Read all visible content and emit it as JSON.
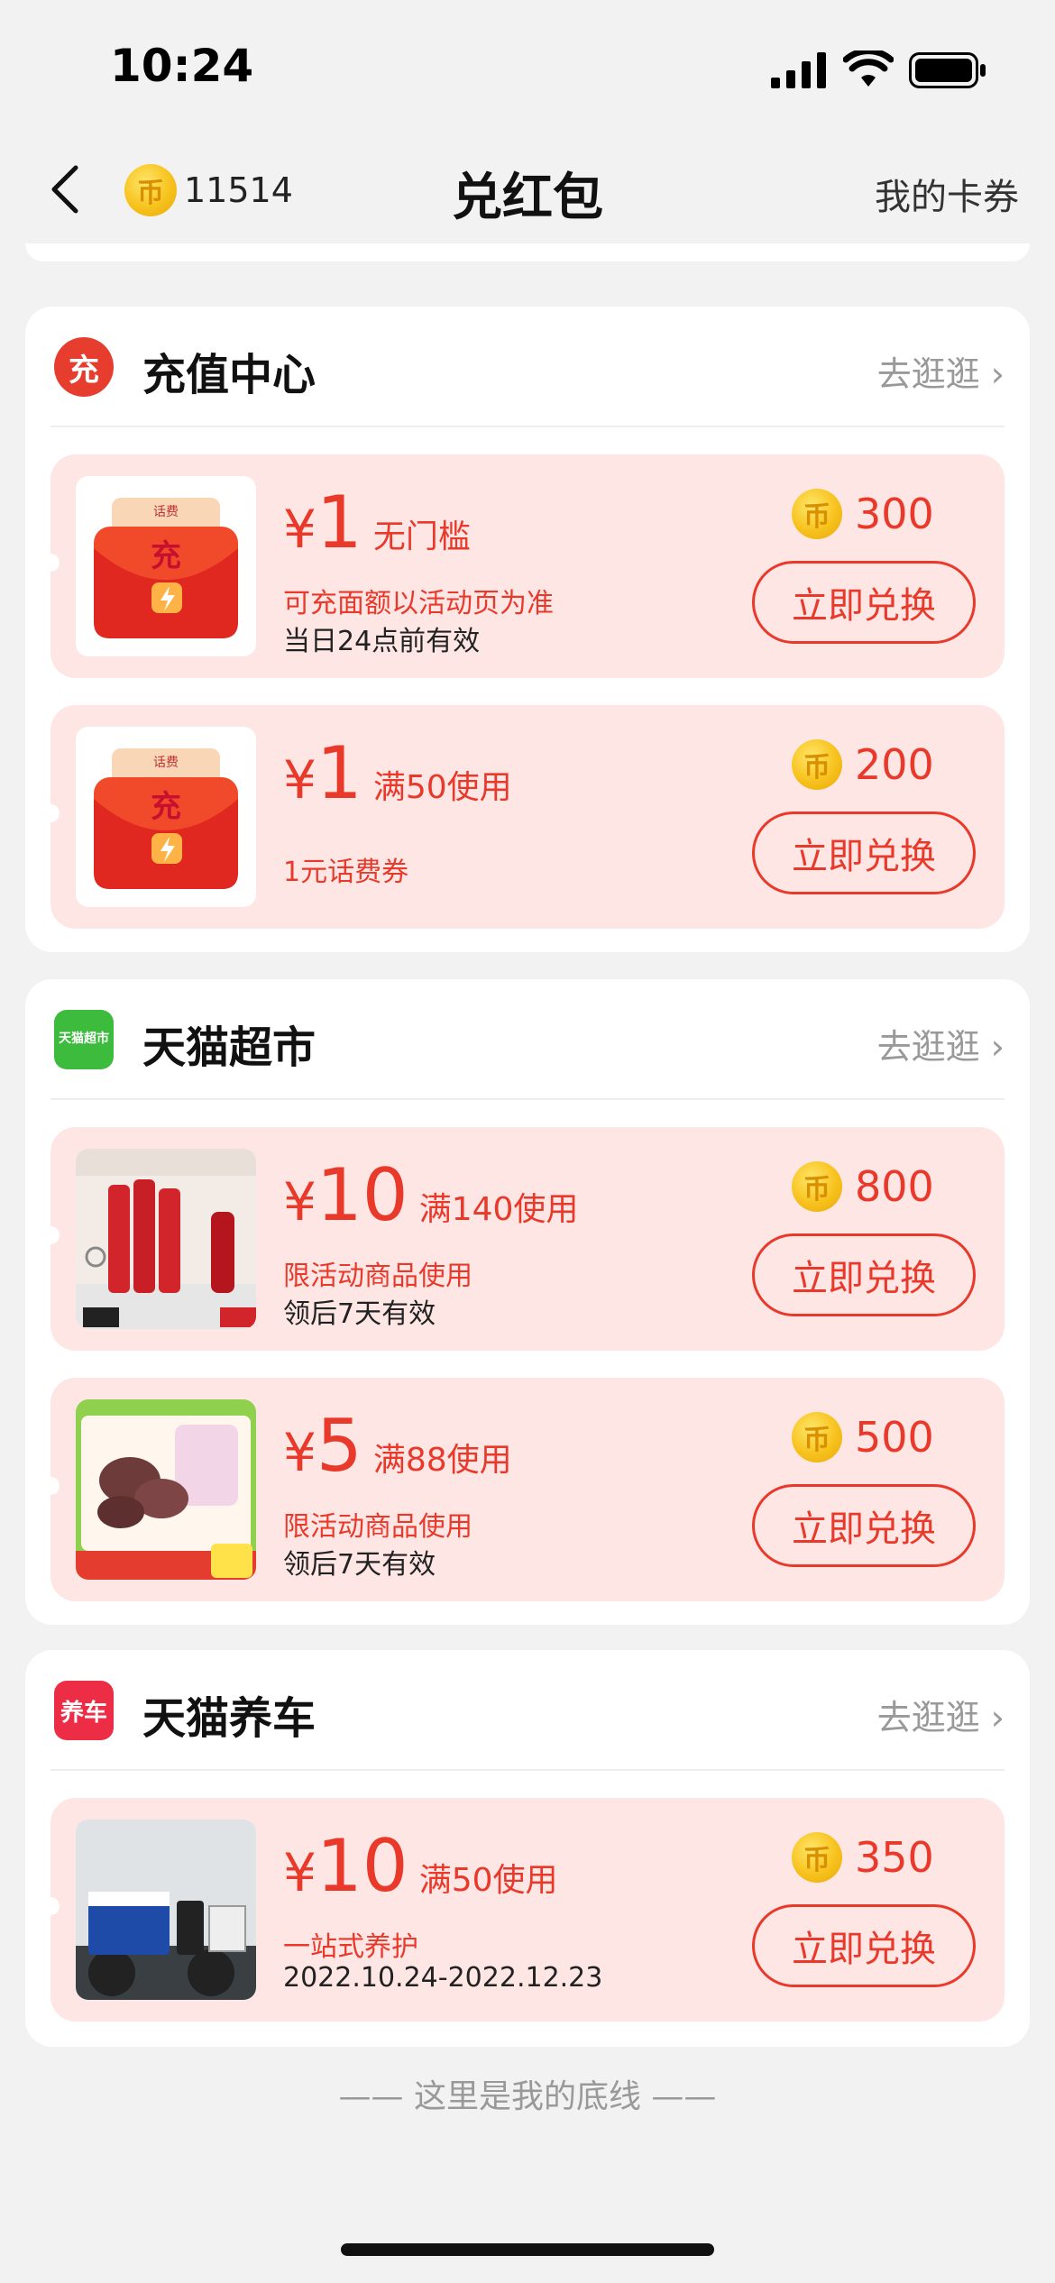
{
  "status_bar": {
    "time": "10:24"
  },
  "nav": {
    "coin_balance": "11514",
    "title": "兑红包",
    "my_coupons": "我的卡券"
  },
  "sections": [
    {
      "title": "充值中心",
      "icon_label": "充",
      "link": "去逛逛",
      "coupons": [
        {
          "currency": "¥",
          "amount": "1",
          "condition": "无门槛",
          "desc": "可充面额以活动页为准",
          "validity": "当日24点前有效",
          "cost": "300",
          "button": "立即兑换",
          "thumb_label_top": "话费",
          "thumb_label": "充"
        },
        {
          "currency": "¥",
          "amount": "1",
          "condition": "满50使用",
          "desc": "1元话费券",
          "validity": "",
          "cost": "200",
          "button": "立即兑换",
          "thumb_label_top": "话费",
          "thumb_label": "充"
        }
      ]
    },
    {
      "title": "天猫超市",
      "icon_label": "天猫超市",
      "link": "去逛逛",
      "coupons": [
        {
          "currency": "¥",
          "amount": "10",
          "condition": "满140使用",
          "desc": "限活动商品使用",
          "validity": "领后7天有效",
          "cost": "800",
          "button": "立即兑换"
        },
        {
          "currency": "¥",
          "amount": "5",
          "condition": "满88使用",
          "desc": "限活动商品使用",
          "validity": "领后7天有效",
          "cost": "500",
          "button": "立即兑换"
        }
      ]
    },
    {
      "title": "天猫养车",
      "icon_label": "养车",
      "link": "去逛逛",
      "coupons": [
        {
          "currency": "¥",
          "amount": "10",
          "condition": "满50使用",
          "desc": "一站式养护",
          "validity": "2022.10.24-2022.12.23",
          "cost": "350",
          "button": "立即兑换"
        }
      ]
    }
  ],
  "footer": "—— 这里是我的底线 ——",
  "colors": {
    "accent": "#e8392b",
    "coupon_bg": "#fde6e4",
    "page_bg": "#f2f2f2"
  }
}
